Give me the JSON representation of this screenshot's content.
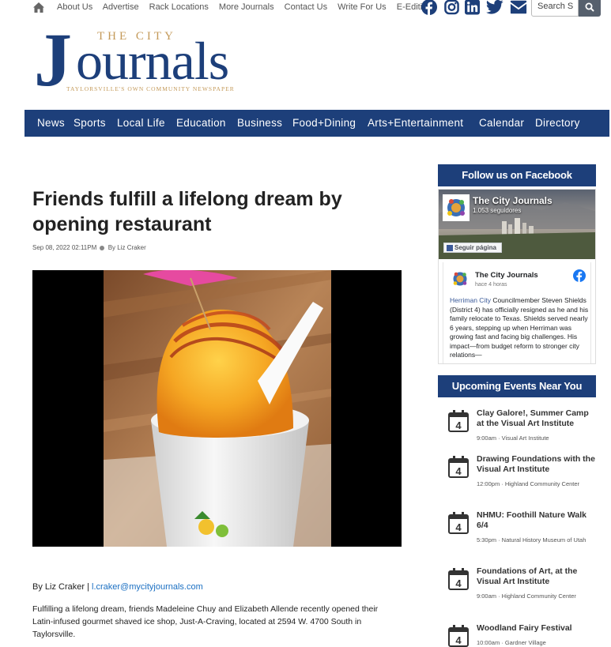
{
  "top_links": [
    "About Us",
    "Advertise",
    "Rack Locations",
    "More Journals",
    "Contact Us",
    "Write For Us",
    "E-Edition"
  ],
  "search": {
    "placeholder": "Search S"
  },
  "logo": {
    "the_city": "THE CITY",
    "j": "J",
    "ournals": "ournals",
    "tagline": "TAYLORSVILLE'S OWN COMMUNITY NEWSPAPER"
  },
  "nav": [
    "News",
    "Sports",
    "Local Life",
    "Education",
    "Business",
    "Food+Dining",
    "Arts+Entertainment",
    "Calendar",
    "Directory"
  ],
  "article": {
    "headline": "Friends fulfill a lifelong dream by opening restaurant",
    "date": "Sep 08, 2022 02:11PM",
    "byline": "By Liz Craker",
    "author_prefix": "By Liz Craker | ",
    "author_email": "l.craker@mycityjournals.com",
    "body": "Fulfilling a lifelong dream, friends Madeleine Chuy and Elizabeth Allende recently opened their Latin-infused gourmet shaved ice shop, Just-A-Craving, located at 2594 W. 4700 South in Taylorsville."
  },
  "sidebar": {
    "facebook_heading": "Follow us on Facebook",
    "fb_page_name": "The City Journals",
    "fb_followers": "1.053 seguidores",
    "fb_follow_label": "Seguir página",
    "fb_post_name": "The City Journals",
    "fb_post_time": "hace 4 horas",
    "fb_post_link": "Herriman City",
    "fb_post_text": " Councilmember Steven Shields (District 4) has officially resigned as he and his family relocate to Texas. Shields served nearly 6 years, stepping up when Herriman was growing fast and facing big challenges. His impact—from budget reform to stronger city relations—",
    "events_heading": "Upcoming Events Near You",
    "events": [
      {
        "day": "4",
        "title": "Clay Galore!, Summer Camp at the Visual Art Institute",
        "meta": "9:00am · Visual Art Institute"
      },
      {
        "day": "4",
        "title": "Drawing Foundations with the Visual Art Institute",
        "meta": "12:00pm · Highland Community Center"
      },
      {
        "day": "4",
        "title": "NHMU: Foothill Nature Walk 6/4",
        "meta": "5:30pm · Natural History Museum of Utah"
      },
      {
        "day": "4",
        "title": "Foundations of Art, at the Visual Art Institute",
        "meta": "9:00am · Highland Community Center"
      },
      {
        "day": "4",
        "title": "Woodland Fairy Festival",
        "meta": "10:00am · Gardner Village"
      }
    ]
  },
  "colors": {
    "brand_blue": "#1d3f7a",
    "link_blue": "#1a6fc2",
    "gold": "#c49a5a"
  }
}
